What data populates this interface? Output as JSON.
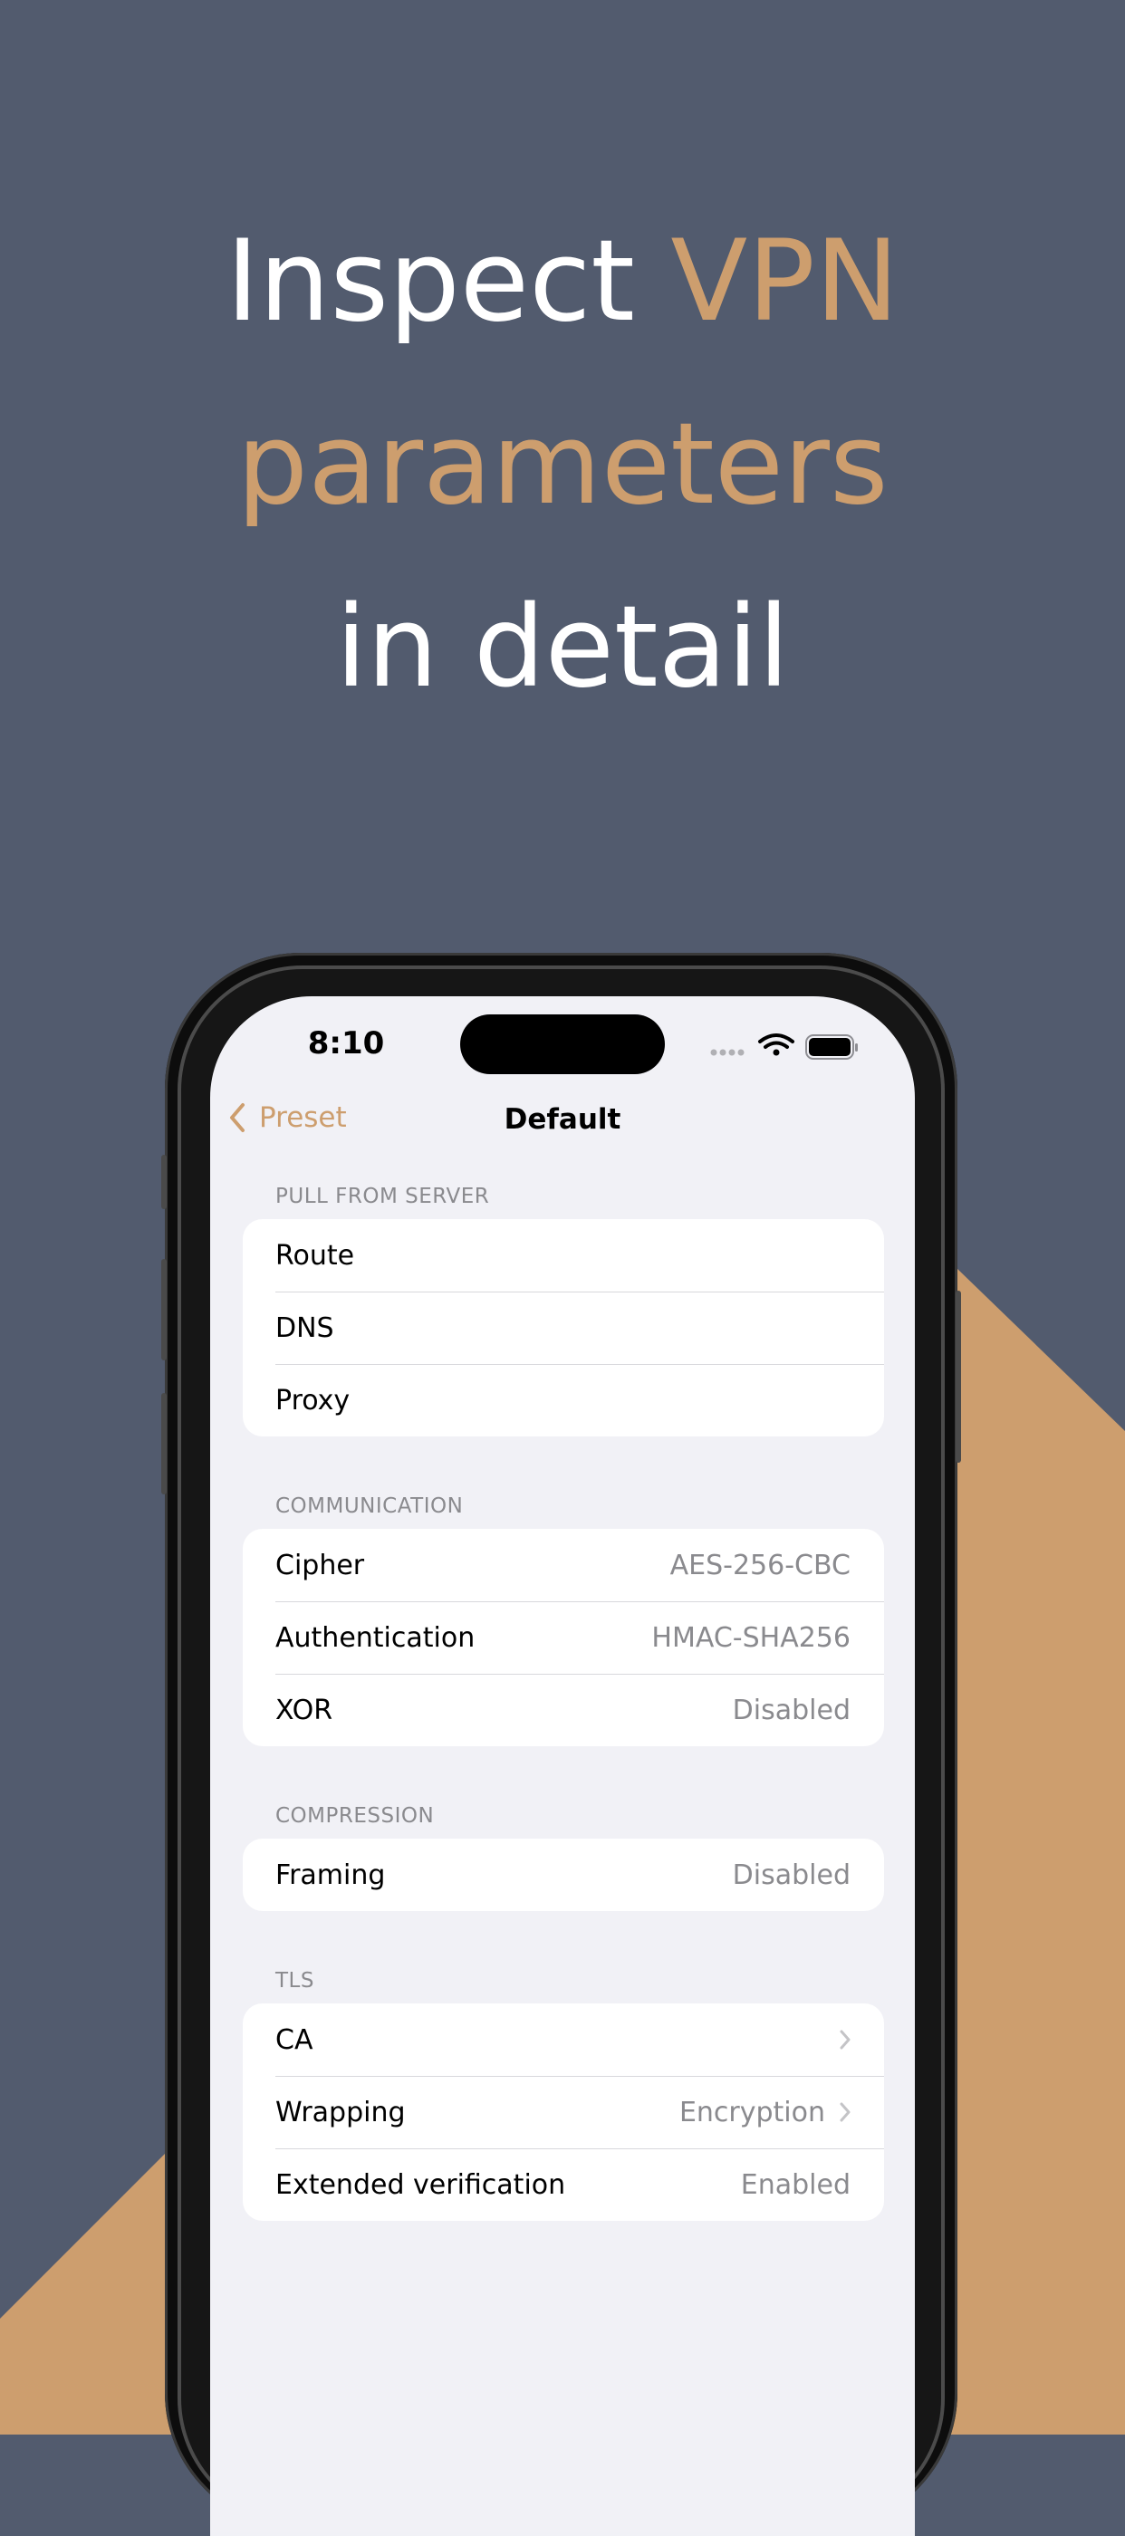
{
  "headline": {
    "line1_white": "Inspect ",
    "line1_accent": "VPN",
    "line2_accent": "parameters",
    "line3_white": "in detail"
  },
  "colors": {
    "background": "#525b6e",
    "accent": "#cd9e6e",
    "screen_background": "#f1f1f6"
  },
  "status_bar": {
    "time": "8:10",
    "icons": [
      "signal-dots-icon",
      "wifi-icon",
      "battery-icon"
    ]
  },
  "nav": {
    "back_label": "Preset",
    "title": "Default"
  },
  "sections": [
    {
      "header": "PULL FROM SERVER",
      "rows": [
        {
          "label": "Route",
          "value": ""
        },
        {
          "label": "DNS",
          "value": ""
        },
        {
          "label": "Proxy",
          "value": ""
        }
      ]
    },
    {
      "header": "COMMUNICATION",
      "rows": [
        {
          "label": "Cipher",
          "value": "AES-256-CBC"
        },
        {
          "label": "Authentication",
          "value": "HMAC-SHA256"
        },
        {
          "label": "XOR",
          "value": "Disabled"
        }
      ]
    },
    {
      "header": "COMPRESSION",
      "rows": [
        {
          "label": "Framing",
          "value": "Disabled"
        }
      ]
    },
    {
      "header": "TLS",
      "rows": [
        {
          "label": "CA",
          "value": "",
          "chevron": true
        },
        {
          "label": "Wrapping",
          "value": "Encryption",
          "chevron": true
        },
        {
          "label": "Extended verification",
          "value": "Enabled"
        }
      ]
    }
  ]
}
